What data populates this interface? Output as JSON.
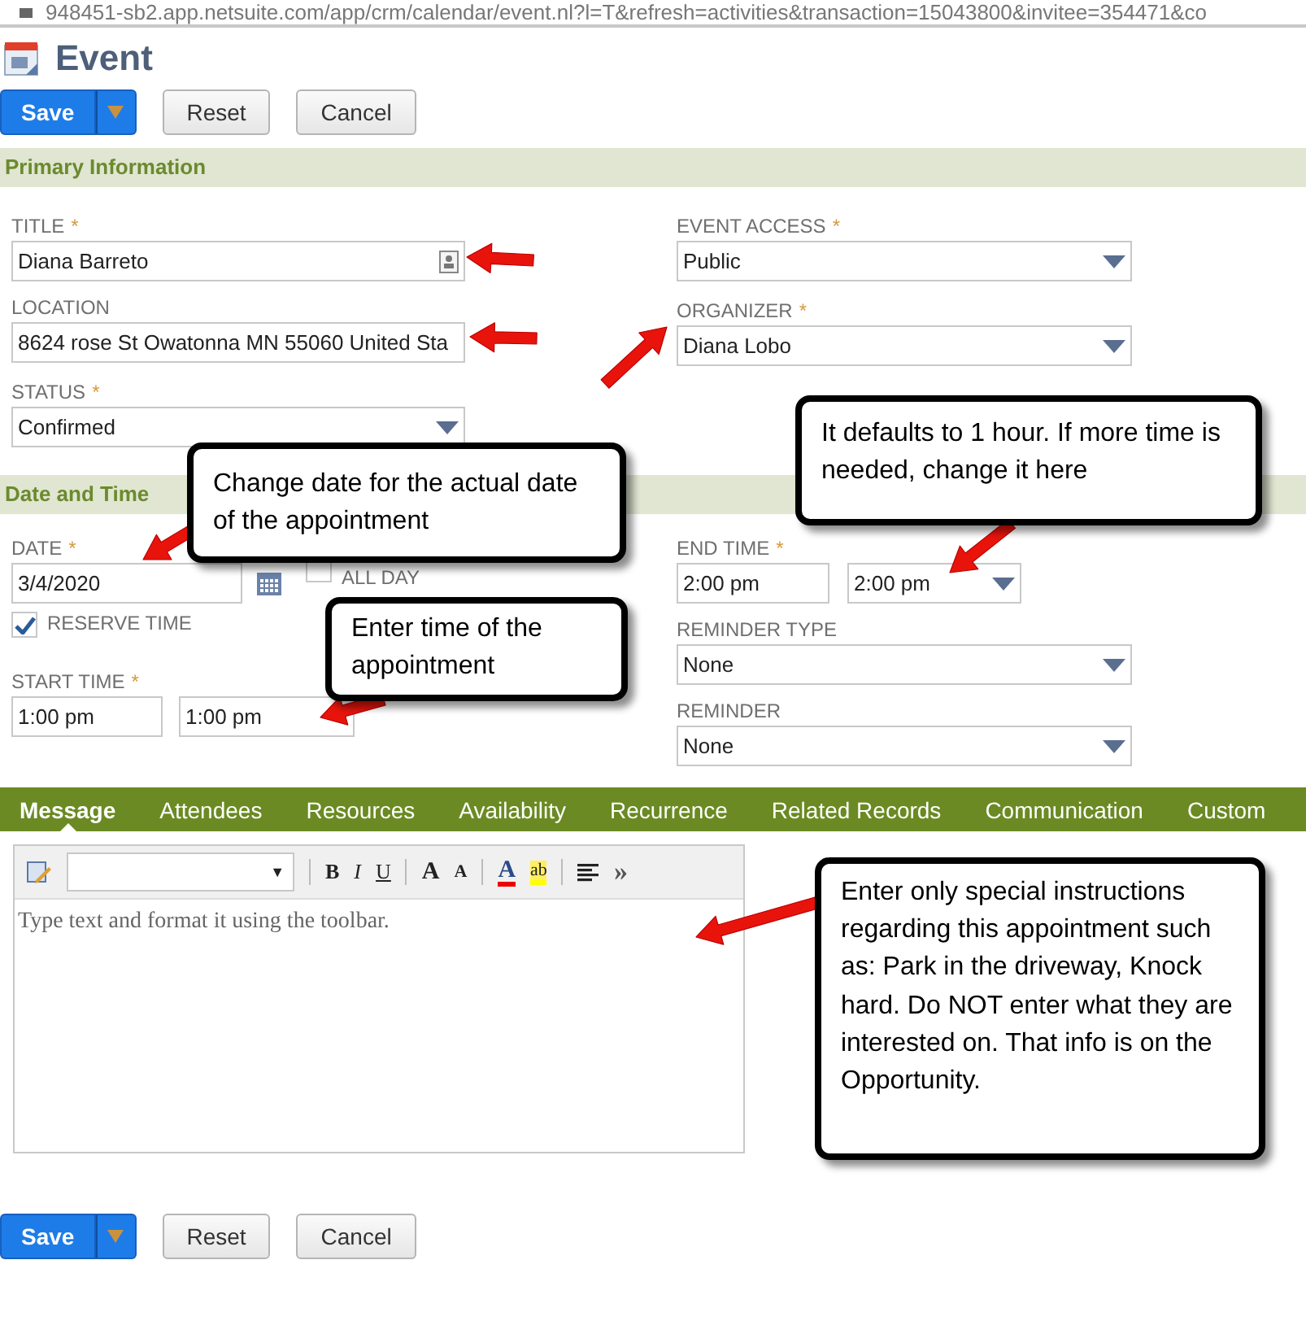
{
  "address_bar": {
    "url": "948451-sb2.app.netsuite.com/app/crm/calendar/event.nl?l=T&refresh=activities&transaction=15043800&invitee=354471&co"
  },
  "page_title": "Event",
  "required_marker": "*",
  "top_buttons": [
    {
      "label": "Save",
      "kind": "primary"
    },
    {
      "label": "Reset",
      "kind": "secondary"
    },
    {
      "label": "Cancel",
      "kind": "secondary"
    }
  ],
  "primary_information": {
    "title": "Primary Information",
    "left": [
      {
        "label": "TITLE",
        "required": true,
        "value": "Diana Barreto",
        "kind": "lookup"
      },
      {
        "label": "LOCATION",
        "required": false,
        "value": "8624 rose St Owatonna MN 55060 United Sta",
        "kind": "text"
      },
      {
        "label": "STATUS",
        "required": true,
        "value": "Confirmed",
        "kind": "select"
      }
    ],
    "right": [
      {
        "label": "EVENT ACCESS",
        "required": true,
        "value": "Public",
        "kind": "select"
      },
      {
        "label": "ORGANIZER",
        "required": true,
        "value": "Diana Lobo",
        "kind": "select"
      }
    ]
  },
  "date_and_time": {
    "title": "Date and Time",
    "date": {
      "label": "DATE",
      "required": true,
      "value": "3/4/2020",
      "all_day": {
        "label": "ALL DAY",
        "checked": false
      }
    },
    "reserve_time": {
      "label": "RESERVE TIME",
      "checked": true
    },
    "start_time": {
      "label": "START TIME",
      "required": true,
      "values": [
        "1:00 pm",
        "1:00 pm"
      ]
    },
    "end_time": {
      "label": "END TIME",
      "required": true,
      "values": [
        "2:00 pm",
        "2:00 pm"
      ]
    },
    "right": [
      {
        "label": "REMINDER TYPE",
        "required": false,
        "value": "None",
        "kind": "select"
      },
      {
        "label": "REMINDER",
        "required": false,
        "value": "None",
        "kind": "select"
      }
    ]
  },
  "tabs": [
    {
      "label": "Message",
      "selected": true
    },
    {
      "label": "Attendees",
      "selected": false
    },
    {
      "label": "Resources",
      "selected": false
    },
    {
      "label": "Availability",
      "selected": false
    },
    {
      "label": "Recurrence",
      "selected": false
    },
    {
      "label": "Related Records",
      "selected": false
    },
    {
      "label": "Communication",
      "selected": false
    },
    {
      "label": "Custom",
      "selected": false
    }
  ],
  "editor": {
    "toolbar": [
      {
        "kind": "edit"
      },
      {
        "kind": "font_select",
        "caret": "▼"
      },
      {
        "kind": "sep"
      },
      {
        "kind": "bold",
        "label": "B"
      },
      {
        "kind": "italic",
        "label": "I"
      },
      {
        "kind": "underline",
        "label": "U"
      },
      {
        "kind": "sep"
      },
      {
        "kind": "grow",
        "label": "A"
      },
      {
        "kind": "shrink",
        "label": "A"
      },
      {
        "kind": "sep"
      },
      {
        "kind": "font_color",
        "label": "A"
      },
      {
        "kind": "highlight",
        "label": "ab"
      },
      {
        "kind": "sep"
      },
      {
        "kind": "align"
      },
      {
        "kind": "more",
        "label": "»"
      }
    ],
    "placeholder": "Type text and format it using the toolbar."
  },
  "bottom_buttons": [
    {
      "label": "Save",
      "kind": "primary"
    },
    {
      "label": "Reset",
      "kind": "secondary"
    },
    {
      "label": "Cancel",
      "kind": "secondary"
    }
  ],
  "callouts": [
    {
      "text": "Change date for the actual date of the appointment"
    },
    {
      "text": "It defaults to 1 hour. If more time is needed, change it here"
    },
    {
      "text": "Enter time of the appointment"
    },
    {
      "text": "Enter only special instructions regarding this appointment such as: Park in the driveway, Knock hard.  Do NOT enter what they are interested on. That info is on the Opportunity."
    }
  ]
}
